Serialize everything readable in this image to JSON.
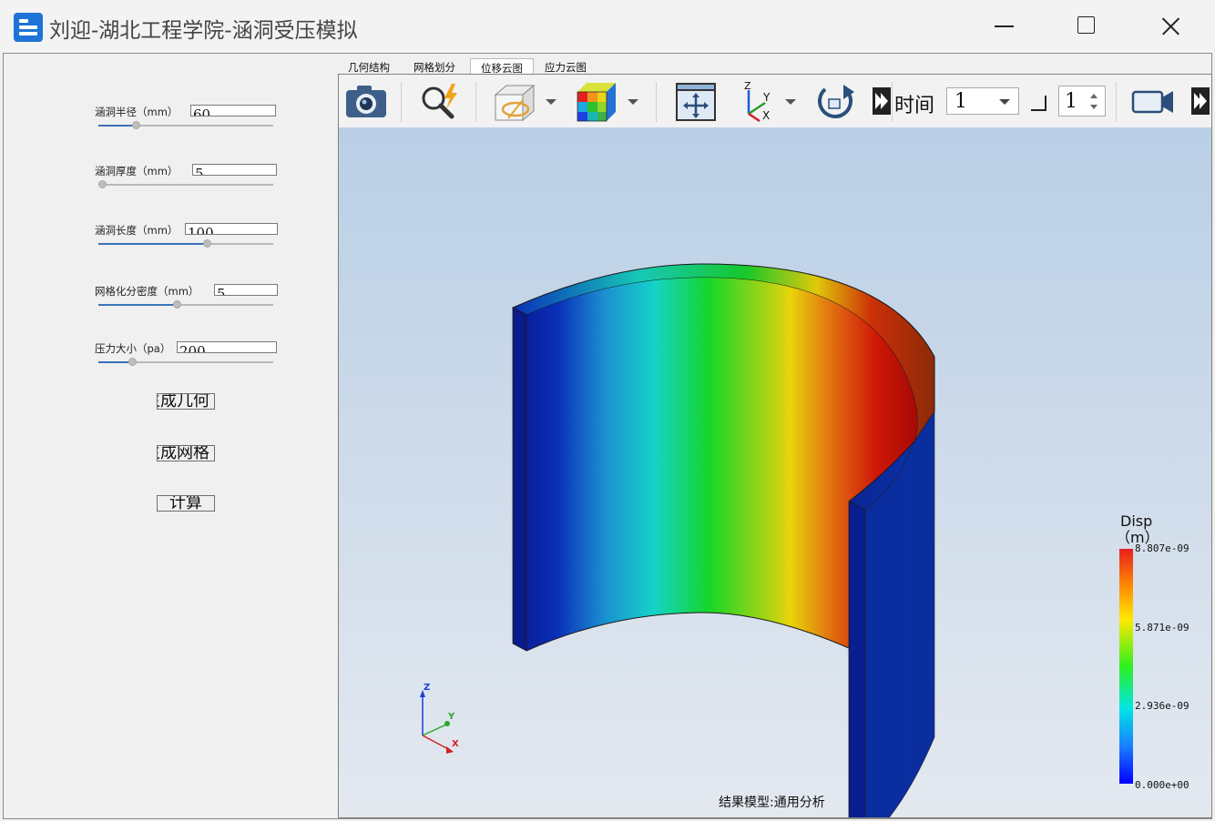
{
  "window": {
    "title": "刘迎-湖北工程学院-涵洞受压模拟"
  },
  "params": [
    {
      "label": "涵洞半径（mm）",
      "value": "60",
      "slider_fraction": 0.2
    },
    {
      "label": "涵洞厚度（mm）",
      "value": "5",
      "slider_fraction": 0.0
    },
    {
      "label": "涵洞长度（mm）",
      "value": "100",
      "slider_fraction": 0.63
    },
    {
      "label": "网格化分密度（mm）",
      "value": "5",
      "slider_fraction": 0.45
    },
    {
      "label": "压力大小（pa）",
      "value": "200",
      "slider_fraction": 0.18
    }
  ],
  "buttons": {
    "gen_geometry": "生成几何",
    "gen_mesh": "生成网格",
    "compute": "计算"
  },
  "tabs": [
    "几何结构",
    "网格划分",
    "位移云图",
    "应力云图"
  ],
  "active_tab": "位移云图",
  "toolbar": {
    "time_label": "时间",
    "time_value": "1",
    "step_value": "1"
  },
  "legend": {
    "title_line1": "Disp",
    "title_line2": "（m）",
    "max": "8.807e-09",
    "v2": "5.871e-09",
    "v3": "2.936e-09",
    "min": "0.000e+00"
  },
  "axes": {
    "x": "X",
    "y": "Y",
    "z": "Z"
  },
  "model_label": "结果模型:通用分析",
  "icons": [
    "camera-icon",
    "zoom-icon",
    "clip-plane-icon",
    "color-cube-icon",
    "fit-view-icon",
    "axis-view-icon",
    "rotate-icon",
    "record-icon"
  ]
}
